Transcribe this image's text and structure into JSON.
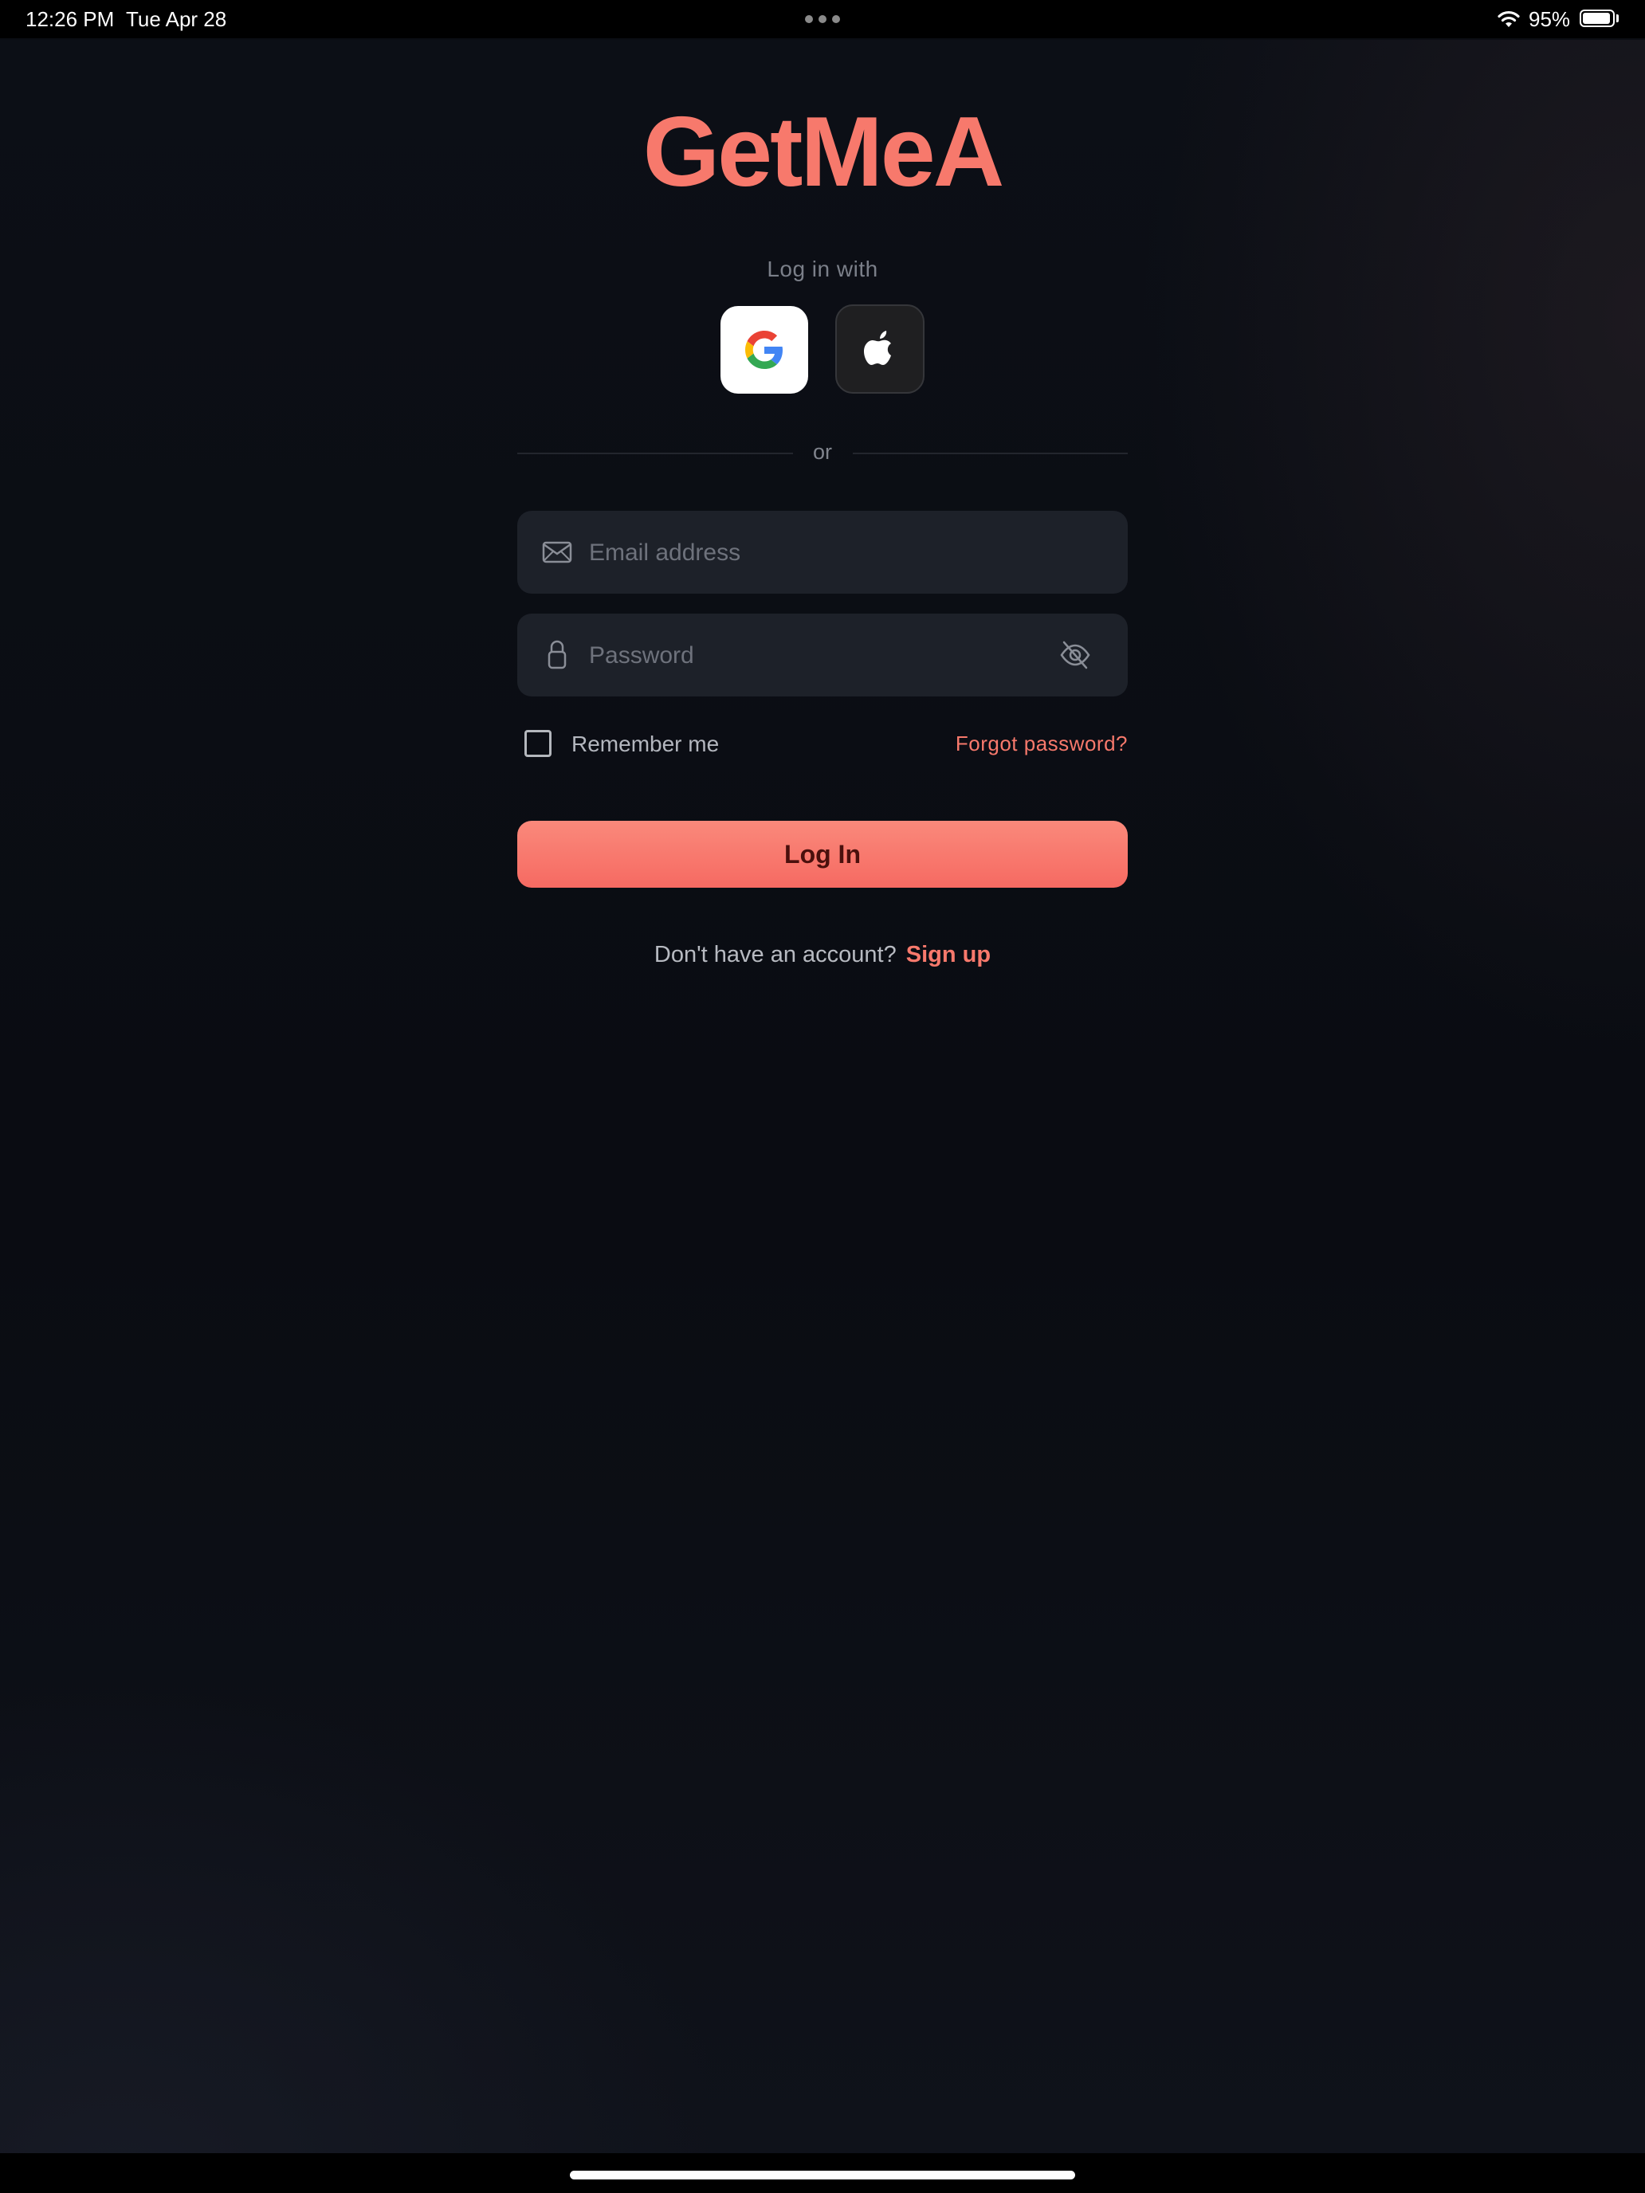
{
  "status_bar": {
    "time": "12:26 PM",
    "date": "Tue Apr 28",
    "battery_text": "95%",
    "battery_level": 0.95
  },
  "brand": {
    "logo_text": "GetMeA",
    "accent_color": "#f7796c"
  },
  "social_login": {
    "heading": "Log in with",
    "providers": [
      {
        "name": "Google",
        "icon": "google-icon"
      },
      {
        "name": "Apple",
        "icon": "apple-icon"
      }
    ]
  },
  "divider_text": "or",
  "form": {
    "email": {
      "placeholder": "Email address",
      "value": "",
      "icon": "envelope-icon"
    },
    "password": {
      "placeholder": "Password",
      "value": "",
      "icon": "lock-icon",
      "toggle_icon": "eye-slash-icon"
    },
    "remember_label": "Remember me",
    "remember_checked": false,
    "forgot_label": "Forgot password?",
    "submit_label": "Log In"
  },
  "signup": {
    "prompt": "Don't have an account?",
    "link_label": "Sign up"
  }
}
